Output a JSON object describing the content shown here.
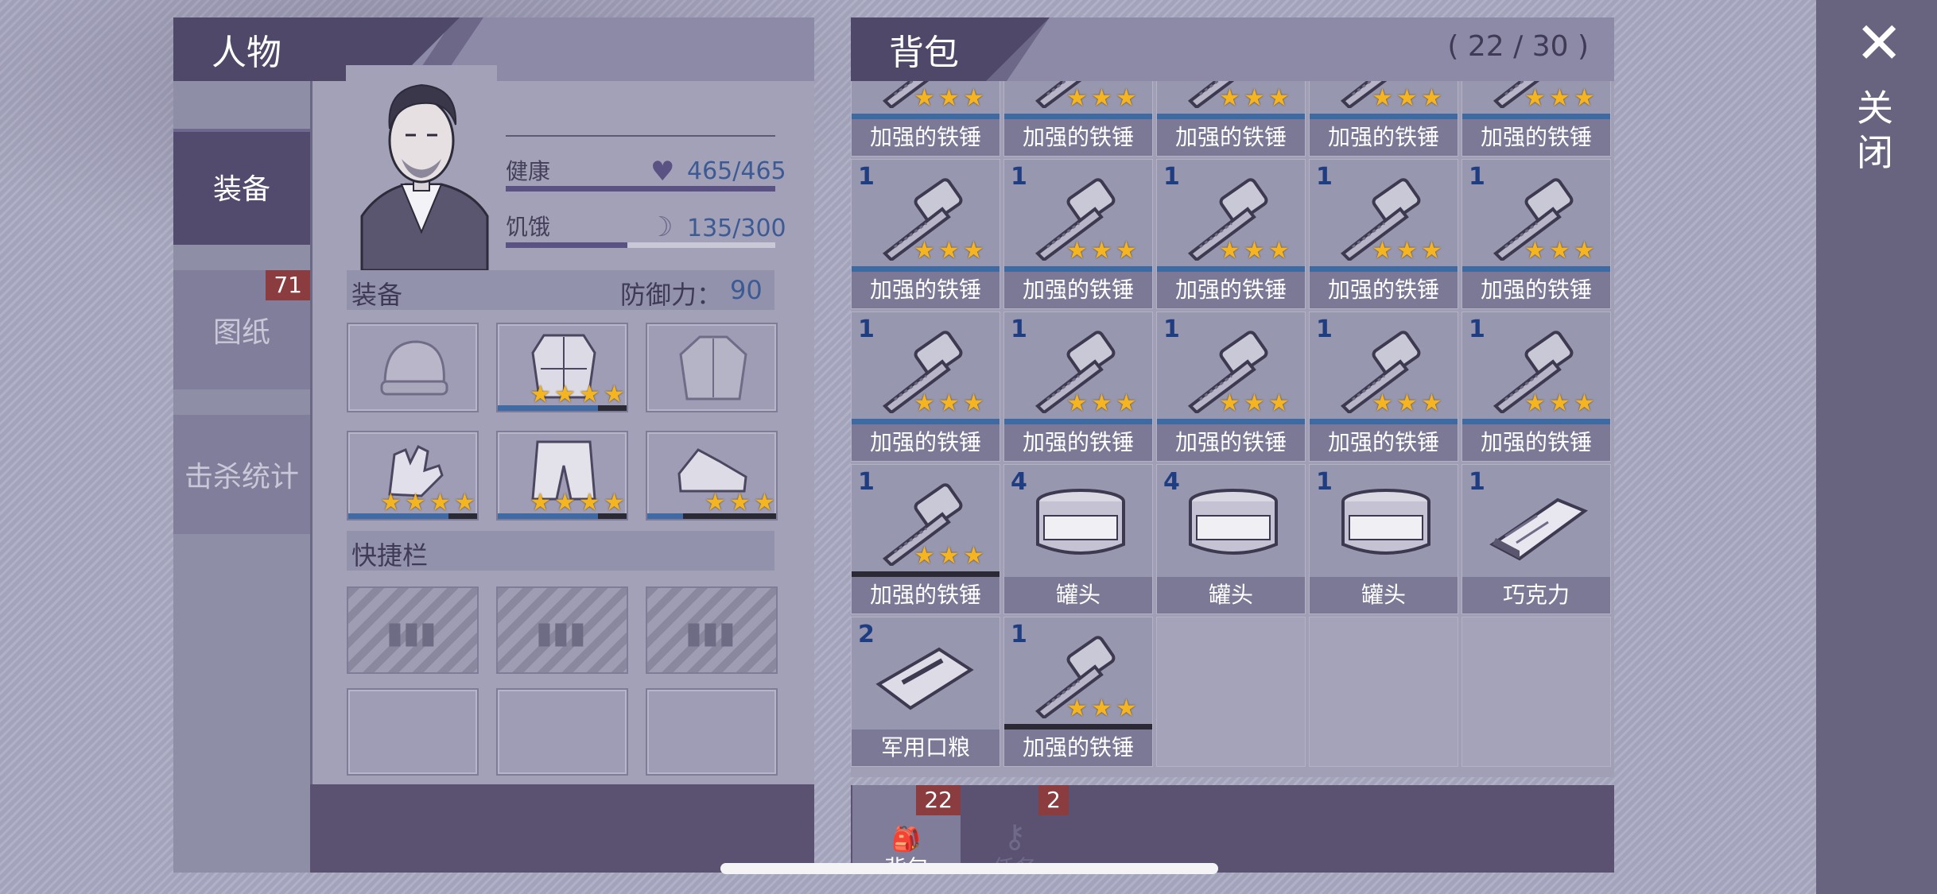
{
  "character": {
    "title": "人物",
    "tabs": [
      {
        "label": "装备",
        "active": true
      },
      {
        "label": "图纸",
        "badge": "71"
      },
      {
        "label": "击杀统计"
      }
    ],
    "stats": {
      "health_label": "健康",
      "health_value": "465/465",
      "health_fraction": 1.0,
      "hunger_label": "饥饿",
      "hunger_value": "135/300",
      "hunger_fraction": 0.45
    },
    "equipment_label": "装备",
    "defense_text": "防御力：",
    "defense_value": "90",
    "slots": [
      {
        "icon": "beanie-hat-icon",
        "stars": 0
      },
      {
        "icon": "armor-vest-icon",
        "stars": 4
      },
      {
        "icon": "jacket-icon",
        "stars": 0
      },
      {
        "icon": "gloves-icon",
        "stars": 4
      },
      {
        "icon": "pants-icon",
        "stars": 4
      },
      {
        "icon": "sneakers-icon",
        "stars": 3
      }
    ],
    "quickbar_label": "快捷栏"
  },
  "bag": {
    "title": "背包",
    "count": "( 22 / 30 )",
    "rows": [
      [
        {
          "qty": "",
          "name": "加强的铁锤",
          "icon": "hammer-icon",
          "stars": 3
        },
        {
          "qty": "",
          "name": "加强的铁锤",
          "icon": "hammer-icon",
          "stars": 3
        },
        {
          "qty": "",
          "name": "加强的铁锤",
          "icon": "hammer-icon",
          "stars": 3
        },
        {
          "qty": "",
          "name": "加强的铁锤",
          "icon": "hammer-icon",
          "stars": 3
        },
        {
          "qty": "",
          "name": "加强的铁锤",
          "icon": "hammer-icon",
          "stars": 3
        }
      ],
      [
        {
          "qty": "1",
          "name": "加强的铁锤",
          "icon": "hammer-icon",
          "stars": 3
        },
        {
          "qty": "1",
          "name": "加强的铁锤",
          "icon": "hammer-icon",
          "stars": 3
        },
        {
          "qty": "1",
          "name": "加强的铁锤",
          "icon": "hammer-icon",
          "stars": 3
        },
        {
          "qty": "1",
          "name": "加强的铁锤",
          "icon": "hammer-icon",
          "stars": 3
        },
        {
          "qty": "1",
          "name": "加强的铁锤",
          "icon": "hammer-icon",
          "stars": 3
        }
      ],
      [
        {
          "qty": "1",
          "name": "加强的铁锤",
          "icon": "hammer-icon",
          "stars": 3
        },
        {
          "qty": "1",
          "name": "加强的铁锤",
          "icon": "hammer-icon",
          "stars": 3
        },
        {
          "qty": "1",
          "name": "加强的铁锤",
          "icon": "hammer-icon",
          "stars": 3
        },
        {
          "qty": "1",
          "name": "加强的铁锤",
          "icon": "hammer-icon",
          "stars": 3
        },
        {
          "qty": "1",
          "name": "加强的铁锤",
          "icon": "hammer-icon",
          "stars": 3
        }
      ],
      [
        {
          "qty": "1",
          "name": "加强的铁锤",
          "icon": "hammer-icon",
          "stars": 3
        },
        {
          "qty": "4",
          "name": "罐头",
          "icon": "can-icon",
          "stars": 0
        },
        {
          "qty": "4",
          "name": "罐头",
          "icon": "can-icon",
          "stars": 0
        },
        {
          "qty": "1",
          "name": "罐头",
          "icon": "can-icon",
          "stars": 0
        },
        {
          "qty": "1",
          "name": "巧克力",
          "icon": "chocolate-icon",
          "stars": 0
        }
      ],
      [
        {
          "qty": "2",
          "name": "军用口粮",
          "icon": "ration-icon",
          "stars": 0
        },
        {
          "qty": "1",
          "name": "加强的铁锤",
          "icon": "hammer-icon",
          "stars": 3
        }
      ]
    ],
    "bottom_tabs": [
      {
        "label": "背包",
        "badge": "22",
        "icon": "backpack-icon"
      },
      {
        "label": "任务",
        "badge": "2",
        "icon": "key-icon"
      }
    ]
  },
  "close": {
    "label": "关闭",
    "icon": "close-x-icon"
  },
  "colors": {
    "accent": "#3c5a93",
    "panel": "#8c8aa6",
    "dark": "#4f4868",
    "star": "#f4b521",
    "badge": "#8a3c3e"
  }
}
